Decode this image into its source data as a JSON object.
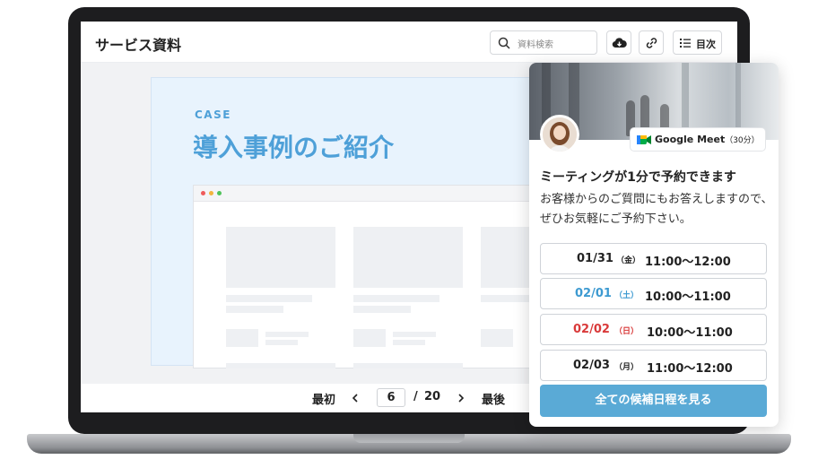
{
  "viewer": {
    "title": "サービス資料",
    "search": {
      "placeholder": "資料検索",
      "icon": "search-icon"
    },
    "toolbar": {
      "download_icon": "download-cloud-icon",
      "link_icon": "link-icon",
      "toc_icon": "list-icon",
      "toc_label": "目次"
    },
    "slide": {
      "eyebrow": "CASE",
      "title": "導入事例のご紹介"
    },
    "pager": {
      "first_label": "最初",
      "prev_icon": "chevron-left-icon",
      "current_page": "6",
      "separator": "/",
      "total_pages": "20",
      "next_icon": "chevron-right-icon",
      "last_label": "最後"
    }
  },
  "booking": {
    "meet_label": "Google Meet",
    "meet_duration": "（30分）",
    "title": "ミーティングが1分で予約できます",
    "description": "お客様からのご質問にもお答えしますので、ぜひお気軽にご予約下さい。",
    "slots": [
      {
        "date": "01/31",
        "weekday": "（金）",
        "time": "11:00〜12:00",
        "color": "#222222"
      },
      {
        "date": "02/01",
        "weekday": "（土）",
        "time": "10:00〜11:00",
        "color": "#3d9ad1"
      },
      {
        "date": "02/02",
        "weekday": "（日）",
        "time": "10:00〜11:00",
        "color": "#d93a3a"
      },
      {
        "date": "02/03",
        "weekday": "（月）",
        "time": "11:00〜12:00",
        "color": "#222222"
      }
    ],
    "all_button_label": "全ての候補日程を見る"
  },
  "colors": {
    "accent": "#4ea0d8",
    "button": "#5aaad6",
    "saturday": "#3d9ad1",
    "sunday": "#d93a3a"
  }
}
